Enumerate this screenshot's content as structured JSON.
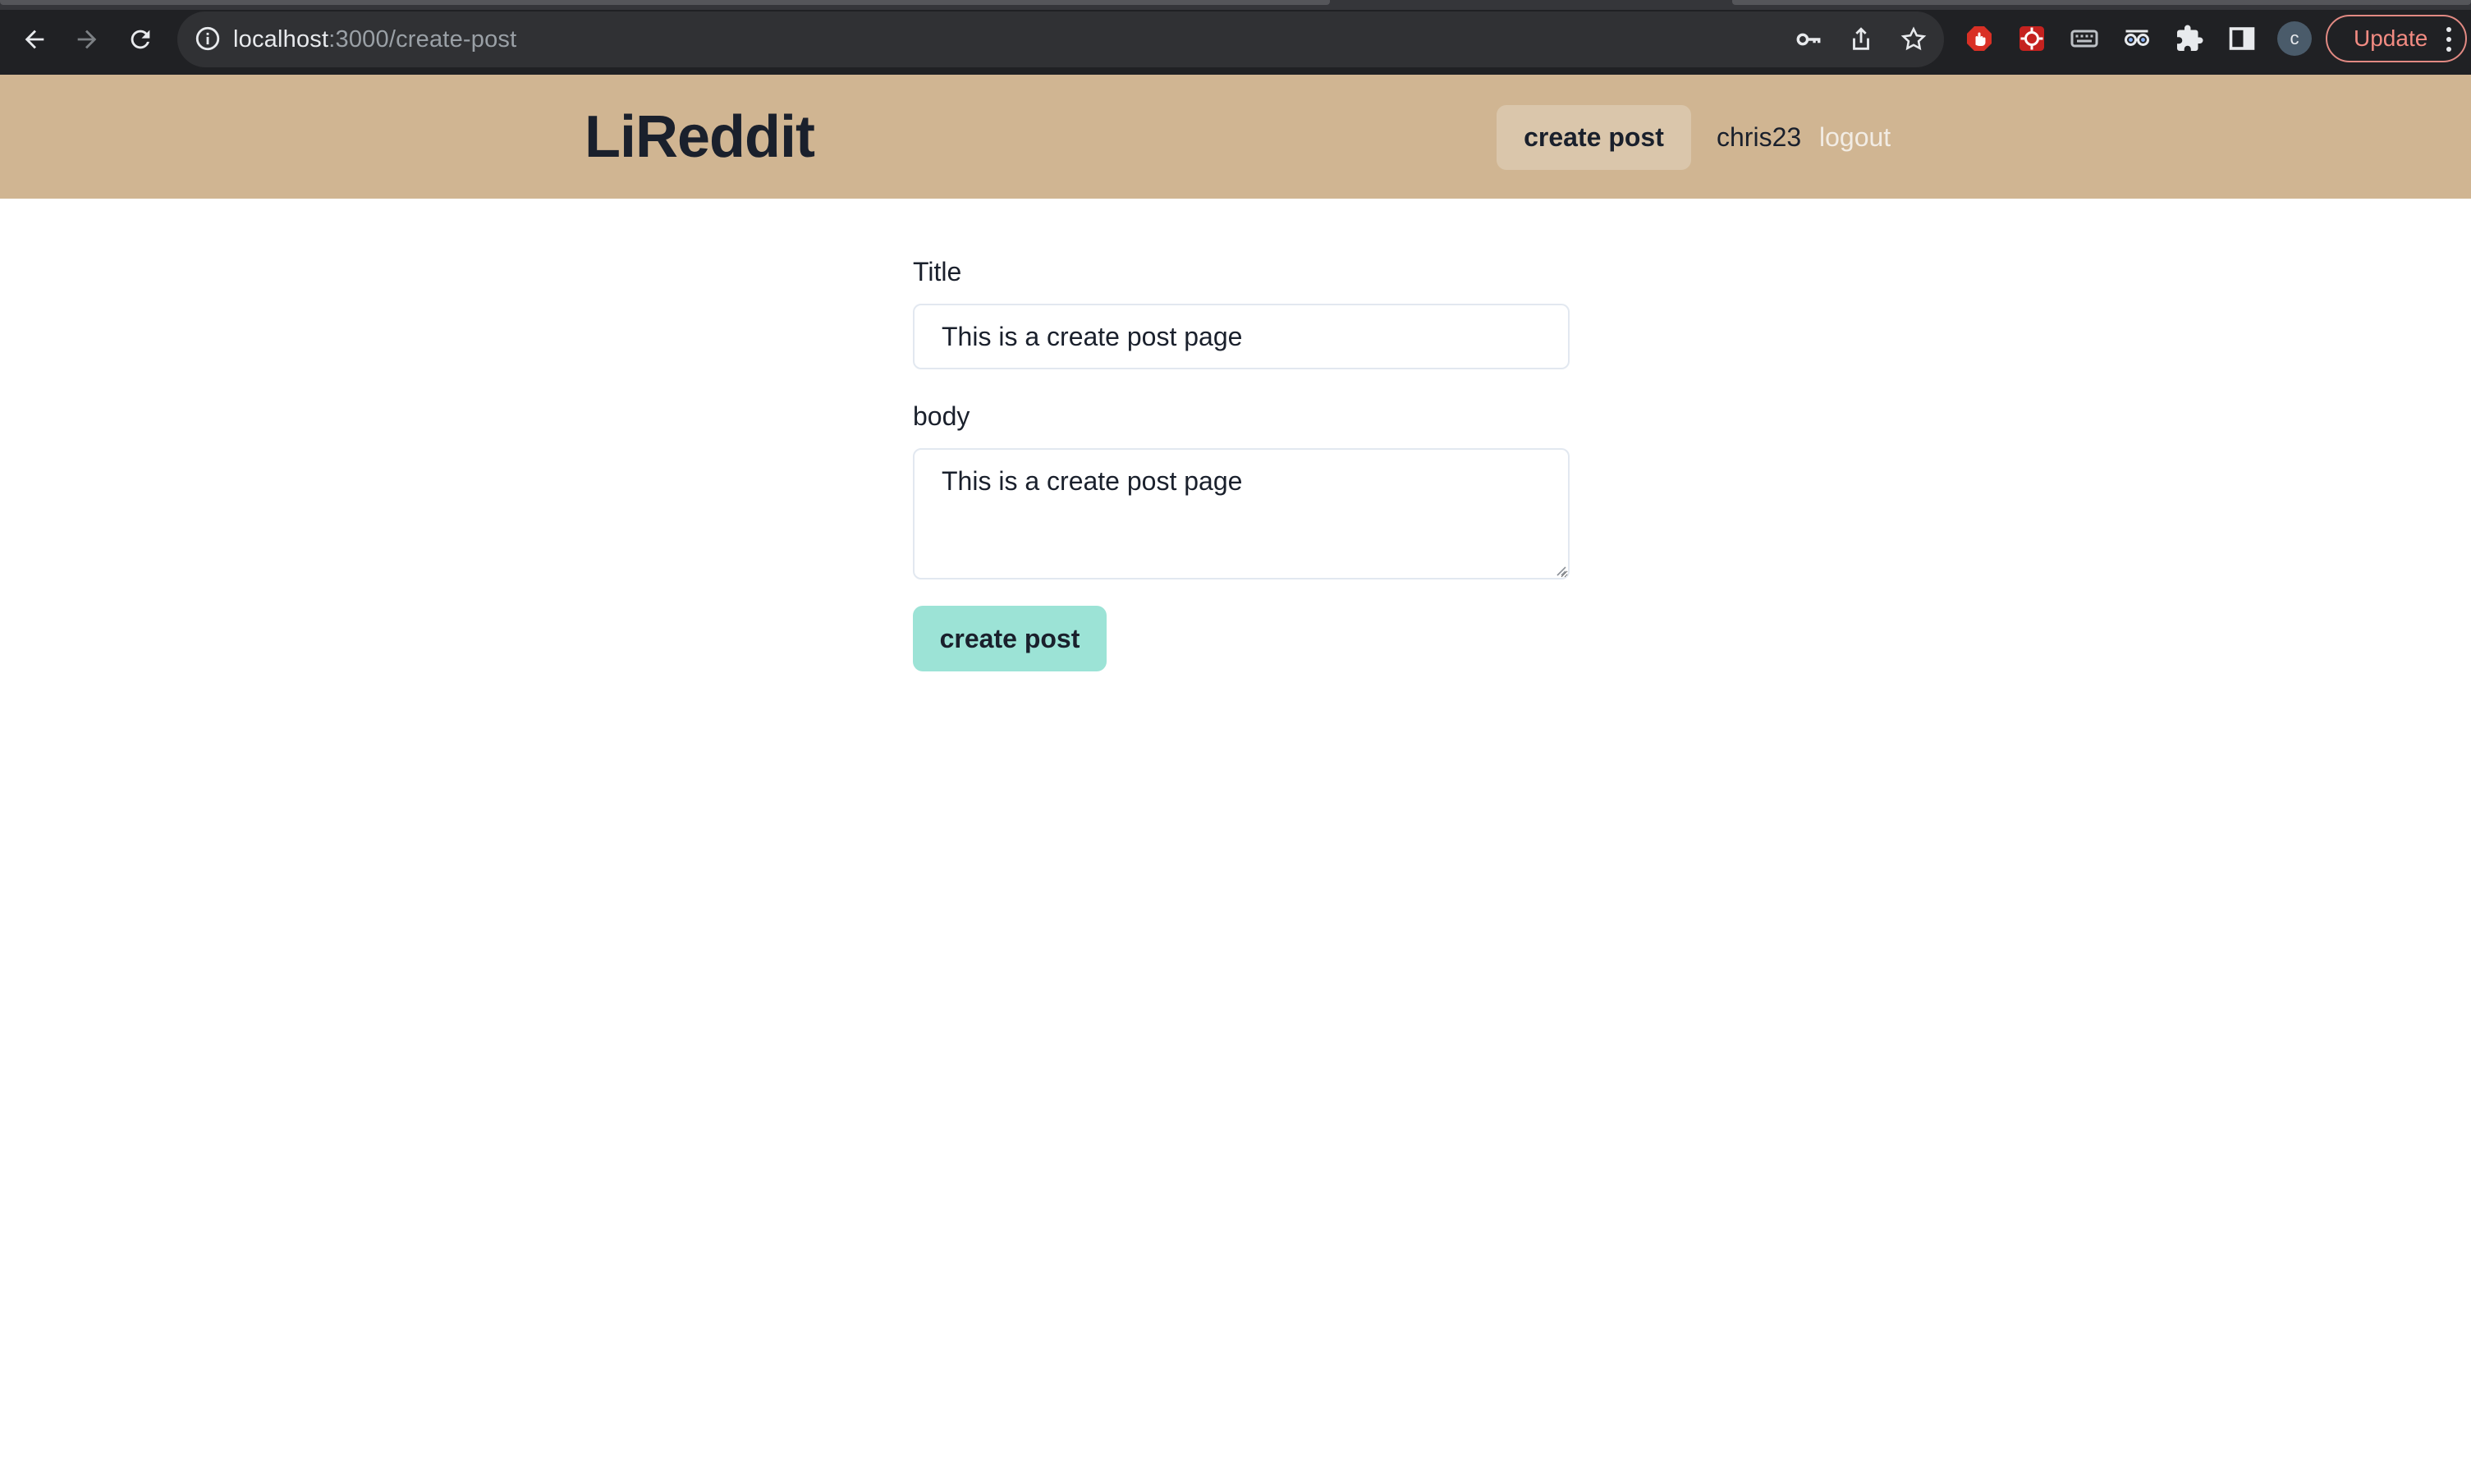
{
  "browser": {
    "url_host": "localhost",
    "url_path": ":3000/create-post",
    "profile_initial": "c",
    "update_label": "Update",
    "icons": [
      "back-icon",
      "forward-icon",
      "reload-icon",
      "site-info-icon",
      "key-icon",
      "share-icon",
      "star-icon",
      "adblock-extension-icon",
      "red-extension-icon",
      "keyboard-extension-icon",
      "glasses-extension-icon",
      "puzzle-extension-icon",
      "side-panel-icon",
      "kebab-menu-icon"
    ]
  },
  "navbar": {
    "brand": "LiReddit",
    "create_post_label": "create post",
    "username": "chris23",
    "logout_label": "logout",
    "background_color": "#d0b592"
  },
  "form": {
    "title_label": "Title",
    "title_value": "This is a create post page",
    "body_label": "body",
    "body_value": "This is a create post page",
    "submit_label": "create post",
    "submit_color": "#9ce3d6"
  }
}
